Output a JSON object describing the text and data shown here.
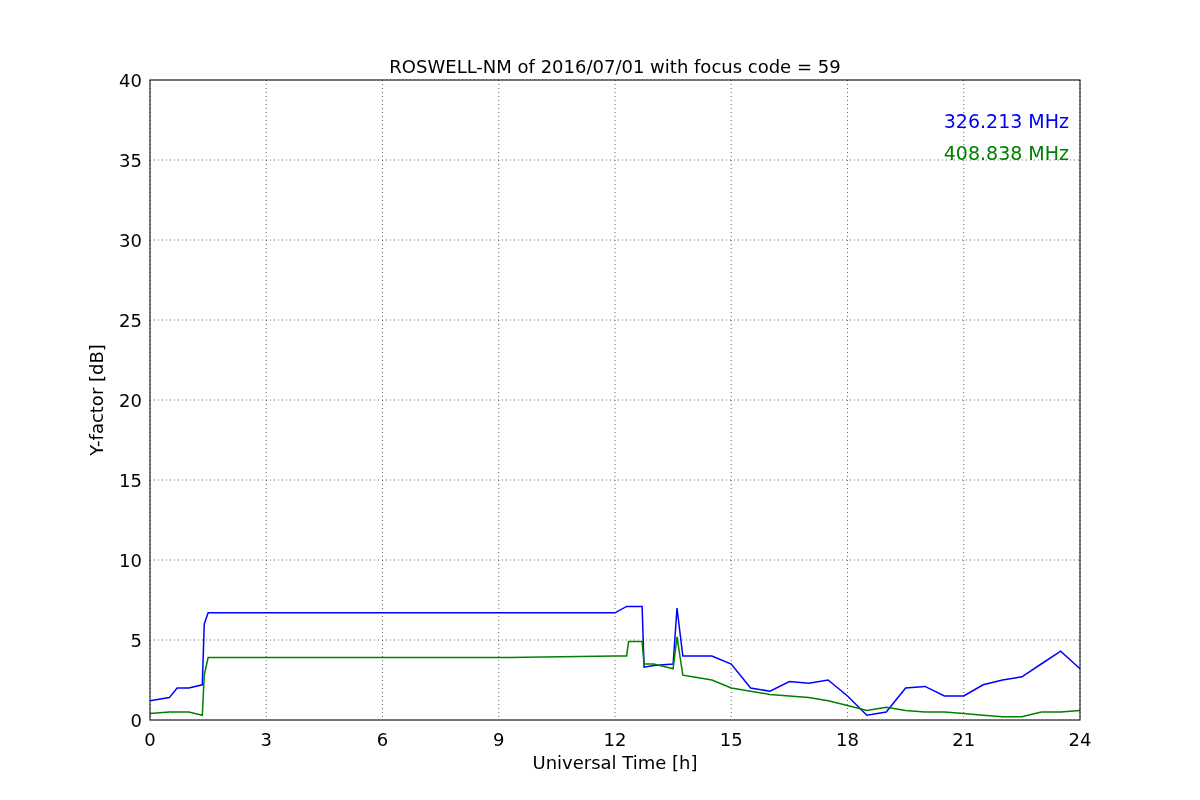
{
  "figure": {
    "chart_data": {
      "type": "line",
      "title": "ROSWELL-NM of 2016/07/01 with focus code = 59",
      "xlabel": "Universal Time [h]",
      "ylabel": "Y-factor [dB]",
      "xlim": [
        0,
        24
      ],
      "ylim": [
        0,
        40
      ],
      "xticks": [
        0,
        3,
        6,
        9,
        12,
        15,
        18,
        21,
        24
      ],
      "yticks": [
        0,
        5,
        10,
        15,
        20,
        25,
        30,
        35,
        40
      ],
      "grid": true,
      "x": [
        0,
        0.5,
        0.7,
        1.0,
        1.35,
        1.4,
        1.5,
        3,
        6,
        9,
        12,
        12.3,
        12.35,
        12.7,
        12.75,
        13,
        13.5,
        13.6,
        13.75,
        14,
        14.5,
        15,
        15.5,
        16,
        16.5,
        17,
        17.5,
        18,
        18.5,
        19,
        19.5,
        20,
        20.5,
        21,
        21.5,
        22,
        22.5,
        23,
        23.5,
        24
      ],
      "series": [
        {
          "name": "326.213 MHz",
          "color": "#0000ff",
          "values": [
            1.2,
            1.4,
            2.0,
            2.0,
            2.2,
            6.0,
            6.7,
            6.7,
            6.7,
            6.7,
            6.7,
            7.1,
            7.1,
            7.1,
            3.3,
            3.4,
            3.5,
            7.0,
            4.0,
            4.0,
            4.0,
            3.5,
            2.0,
            1.8,
            2.4,
            2.3,
            2.5,
            1.5,
            0.3,
            0.5,
            2.0,
            2.1,
            1.5,
            1.5,
            2.2,
            2.5,
            2.7,
            3.5,
            4.3,
            3.2
          ]
        },
        {
          "name": "408.838 MHz",
          "color": "#008000",
          "values": [
            0.4,
            0.5,
            0.5,
            0.5,
            0.3,
            2.8,
            3.9,
            3.9,
            3.9,
            3.9,
            4.0,
            4.0,
            4.9,
            4.9,
            3.5,
            3.5,
            3.2,
            5.2,
            2.8,
            2.7,
            2.5,
            2.0,
            1.8,
            1.6,
            1.5,
            1.4,
            1.2,
            0.9,
            0.6,
            0.8,
            0.6,
            0.5,
            0.5,
            0.4,
            0.3,
            0.2,
            0.2,
            0.5,
            0.5,
            0.6
          ]
        }
      ]
    }
  }
}
